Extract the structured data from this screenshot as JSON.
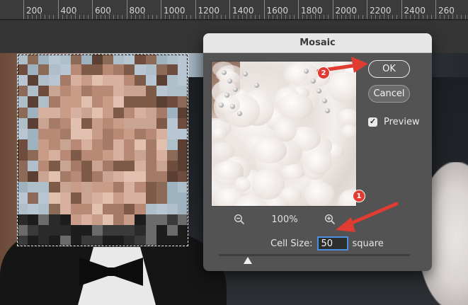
{
  "ruler": {
    "labels": [
      "200",
      "400",
      "600",
      "800",
      "1000",
      "1200",
      "1400",
      "1600",
      "1800",
      "2000",
      "2200",
      "2400",
      "260"
    ]
  },
  "dialog": {
    "title": "Mosaic",
    "ok_label": "OK",
    "cancel_label": "Cancel",
    "preview_label": "Preview",
    "preview_checked": true,
    "zoom_level": "100%",
    "cell_size_label": "Cell Size:",
    "cell_size_value": "50",
    "cell_size_unit": "square",
    "slider_value_fraction": 0.15
  },
  "annotations": {
    "badge_1": "1",
    "badge_2": "2",
    "color": "#e03c31"
  },
  "icons": {
    "zoom_out": "zoom-out-icon",
    "zoom_in": "zoom-in-icon",
    "check": "checkmark-icon"
  }
}
